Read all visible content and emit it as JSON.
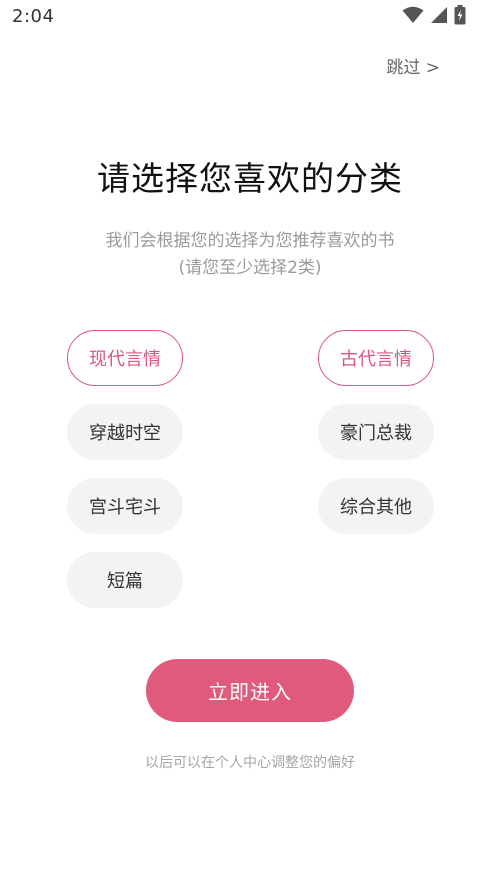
{
  "status_bar": {
    "time": "2:04",
    "icons": [
      "wifi-icon",
      "signal-icon",
      "battery-charging-icon"
    ]
  },
  "header": {
    "skip_label": "跳过 >"
  },
  "main": {
    "title": "请选择您喜欢的分类",
    "subtitle_line1": "我们会根据您的选择为您推荐喜欢的书",
    "subtitle_line2": "(请您至少选择2类)"
  },
  "categories": [
    {
      "label": "现代言情",
      "selected": true
    },
    {
      "label": "古代言情",
      "selected": true
    },
    {
      "label": "穿越时空",
      "selected": false
    },
    {
      "label": "豪门总裁",
      "selected": false
    },
    {
      "label": "宫斗宅斗",
      "selected": false
    },
    {
      "label": "综合其他",
      "selected": false
    },
    {
      "label": "短篇",
      "selected": false
    }
  ],
  "actions": {
    "enter_label": "立即进入"
  },
  "footer": {
    "hint": "以后可以在个人中心调整您的偏好"
  },
  "colors": {
    "accent": "#df5a7d",
    "chip_bg": "#f3f3f3",
    "text_muted": "#9a9a9a"
  }
}
